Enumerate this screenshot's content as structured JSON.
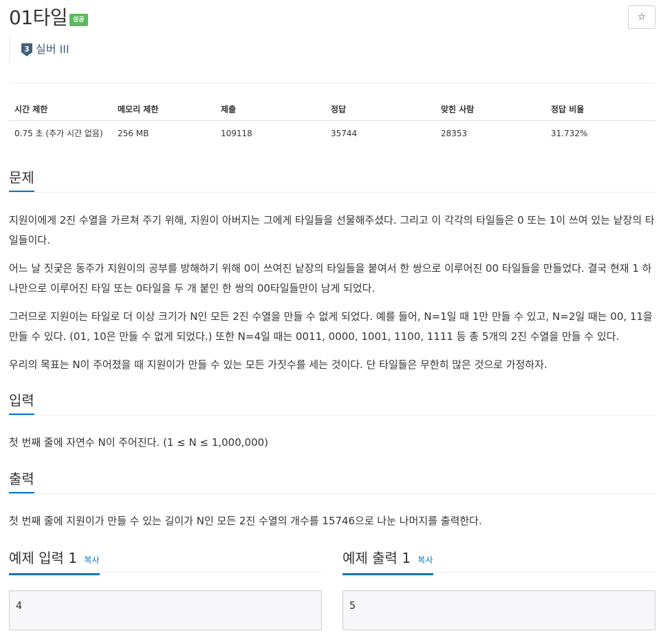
{
  "problem": {
    "title": "01타일",
    "result_badge": "성공",
    "star_label": "☆",
    "tier": {
      "number": "3",
      "label": "실버 III",
      "color": "#435f7a"
    }
  },
  "info_table": {
    "headers": [
      "시간 제한",
      "메모리 제한",
      "제출",
      "정답",
      "맞힌 사람",
      "정답 비율"
    ],
    "values": [
      "0.75 초 (추가 시간 없음)",
      "256 MB",
      "109118",
      "35744",
      "28353",
      "31.732%"
    ]
  },
  "sections": {
    "description": {
      "heading": "문제",
      "paragraphs": [
        "지원이에게 2진 수열을 가르쳐 주기 위해, 지원이 아버지는 그에게 타일들을 선물해주셨다. 그리고 이 각각의 타일들은 0 또는 1이 쓰여 있는 낱장의 타일들이다.",
        "어느 날 짓궂은 동주가 지원이의 공부를 방해하기 위해 0이 쓰여진 낱장의 타일들을 붙여서 한 쌍으로 이루어진 00 타일들을 만들었다. 결국 현재 1 하나만으로 이루어진 타일 또는 0타일을 두 개 붙인 한 쌍의 00타일들만이 남게 되었다.",
        "그러므로 지원이는 타일로 더 이상 크기가 N인 모든 2진 수열을 만들 수 없게 되었다. 예를 들어, N=1일 때 1만 만들 수 있고, N=2일 때는 00, 11을 만들 수 있다. (01, 10은 만들 수 없게 되었다.) 또한 N=4일 때는 0011, 0000, 1001, 1100, 1111 등 총 5개의 2진 수열을 만들 수 있다.",
        "우리의 목표는 N이 주어졌을 때 지원이가 만들 수 있는 모든 가짓수를 세는 것이다. 단 타일들은 무한히 많은 것으로 가정하자."
      ]
    },
    "input": {
      "heading": "입력",
      "text": "첫 번째 줄에 자연수 N이 주어진다. (1 ≤ N ≤ 1,000,000)"
    },
    "output": {
      "heading": "출력",
      "text": "첫 번째 줄에 지원이가 만들 수 있는 길이가 N인 모든 2진 수열의 개수를 15746으로 나눈 나머지를 출력한다."
    }
  },
  "samples": {
    "input": {
      "heading": "예제 입력 1",
      "copy_label": "복사",
      "value": "4"
    },
    "output": {
      "heading": "예제 출력 1",
      "copy_label": "복사",
      "value": "5"
    }
  }
}
